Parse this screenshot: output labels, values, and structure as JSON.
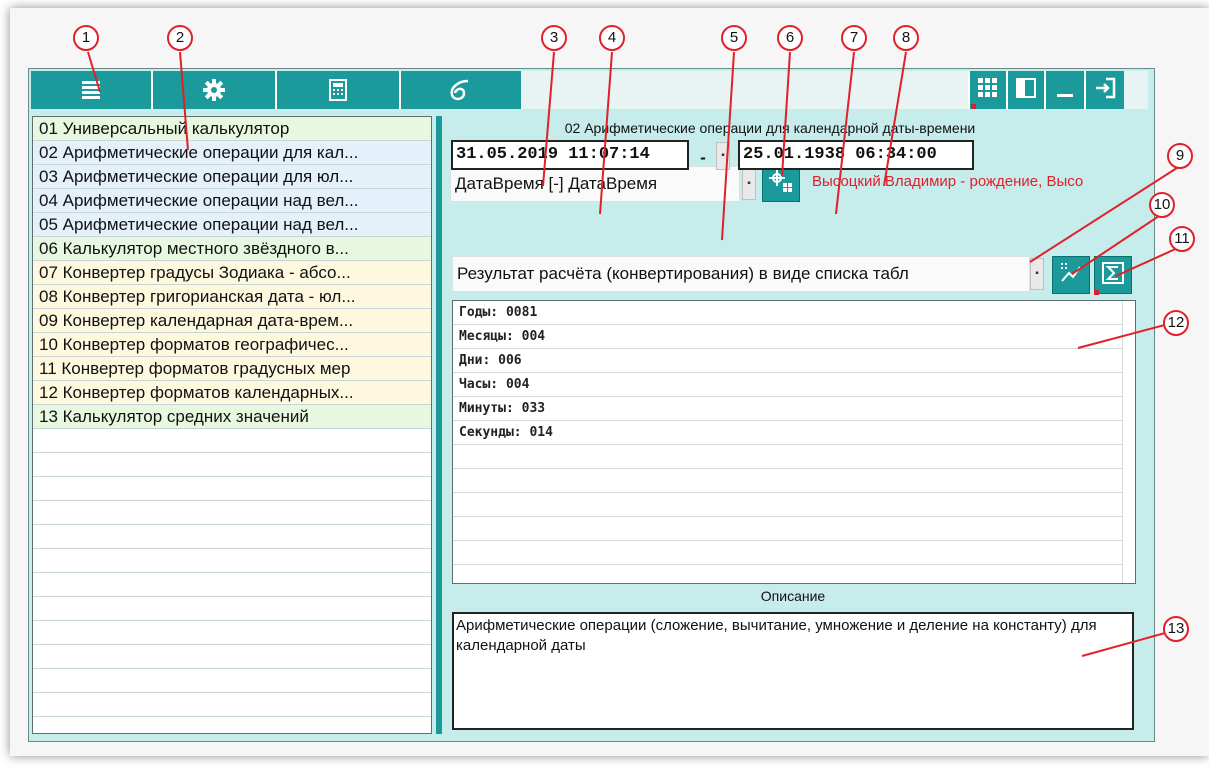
{
  "toolbar": {
    "icons": [
      "list-icon",
      "gear-icon",
      "calculator-icon",
      "logo-6-icon",
      "grid-icon",
      "panel-icon",
      "minimize-icon",
      "exit-icon"
    ]
  },
  "sidebar": {
    "items": [
      {
        "label": "01 Универсальный калькулятор"
      },
      {
        "label": "02 Арифметические операции для кал..."
      },
      {
        "label": "03 Арифметические операции для юл..."
      },
      {
        "label": "04 Арифметические операции над вел..."
      },
      {
        "label": "05 Арифметические операции над вел..."
      },
      {
        "label": "06 Калькулятор местного звёздного в..."
      },
      {
        "label": "07 Конвертер градусы Зодиака - абсо..."
      },
      {
        "label": "08 Конвертер григорианская дата - юл..."
      },
      {
        "label": "09 Конвертер календарная дата-врем..."
      },
      {
        "label": "10 Конвертер форматов географичес..."
      },
      {
        "label": "11 Конвертер форматов градусных мер"
      },
      {
        "label": "12 Конвертер форматов календарных..."
      },
      {
        "label": "13 Калькулятор средних значений"
      }
    ]
  },
  "main": {
    "title": "02 Арифметические операции для календарной даты-времени",
    "operation_type": "ДатаВремя [-] ДатаВремя",
    "person": "Высоцкий Владимир - рождение, Высо",
    "date1": "31.05.2019 11:07:14",
    "operator": "-",
    "date2": "25.01.1938 06:34:00",
    "result_mode": "Результат расчёта (конвертирования) в виде списка табл",
    "results": [
      "Годы: 0081",
      "Месяцы: 004",
      "Дни: 006",
      "Часы: 004",
      "Минуты: 033",
      "Секунды: 014"
    ],
    "description_label": "Описание",
    "description": "Арифметические операции (сложение, вычитание, умножение и деление на константу) для календарной даты"
  },
  "callouts": [
    "1",
    "2",
    "3",
    "4",
    "5",
    "6",
    "7",
    "8",
    "9",
    "10",
    "11",
    "12",
    "13"
  ],
  "colors": {
    "accent": "#1a9a9a",
    "panel": "#c7ecec",
    "callout": "#e0202a"
  }
}
